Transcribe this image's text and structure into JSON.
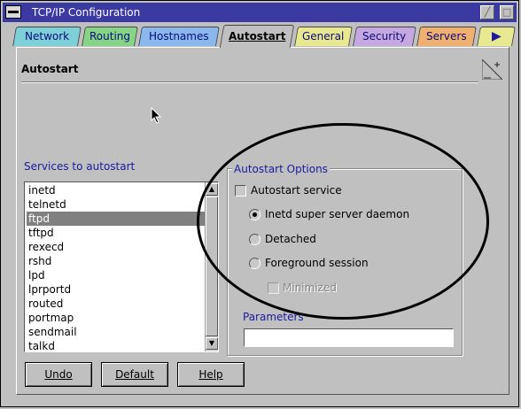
{
  "window": {
    "title": "TCP/IP Configuration"
  },
  "tabs": [
    {
      "label": "Network",
      "color": "#7ed0d8",
      "active": false
    },
    {
      "label": "Routing",
      "color": "#86d486",
      "active": false
    },
    {
      "label": "Hostnames",
      "color": "#8ab8ec",
      "active": false
    },
    {
      "label": "Autostart",
      "color": "#e2b0a8",
      "active": true
    },
    {
      "label": "General",
      "color": "#e8e890",
      "active": false
    },
    {
      "label": "Security",
      "color": "#c6a8e0",
      "active": false
    },
    {
      "label": "Servers",
      "color": "#f0b070",
      "active": false
    }
  ],
  "tab_scroll_icon": "right-arrow-icon",
  "page": {
    "title": "Autostart"
  },
  "services": {
    "label": "Services to autostart",
    "items": [
      "inetd",
      "telnetd",
      "ftpd",
      "tftpd",
      "rexecd",
      "rshd",
      "lpd",
      "lprportd",
      "routed",
      "portmap",
      "sendmail",
      "talkd"
    ],
    "selected": "ftpd"
  },
  "options": {
    "group_label": "Autostart Options",
    "autostart_service": {
      "label": "Autostart service",
      "checked": false
    },
    "radios": [
      {
        "label": "Inetd super server daemon",
        "selected": true
      },
      {
        "label": "Detached",
        "selected": false
      },
      {
        "label": "Foreground session",
        "selected": false
      }
    ],
    "minimized": {
      "label": "Minimized",
      "checked": false,
      "disabled": true
    },
    "parameters_label": "Parameters",
    "parameters_value": ""
  },
  "buttons": {
    "undo": "Undo",
    "default": "Default",
    "help": "Help"
  },
  "colors": {
    "titlebar": "#3a3aa2",
    "selection": "#808080",
    "label_blue": "#1a1aa0"
  }
}
